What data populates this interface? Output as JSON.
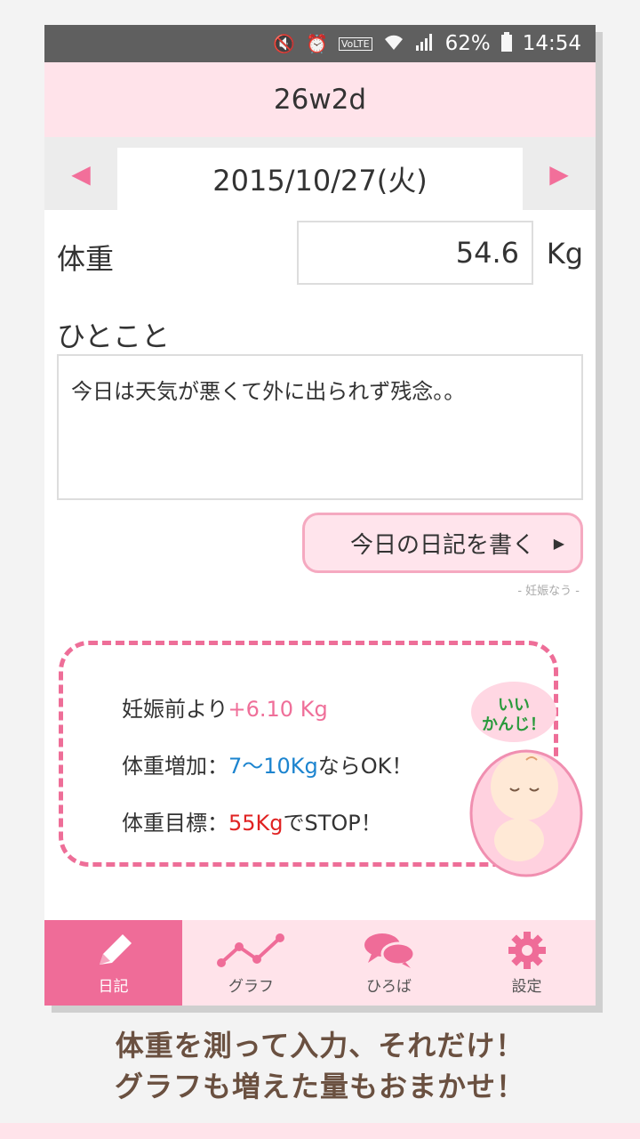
{
  "status_bar": {
    "battery": "62%",
    "time": "14:54",
    "icons": [
      "mute-icon",
      "alarm-icon",
      "volte-icon",
      "wifi-icon",
      "signal-icon",
      "battery-icon"
    ]
  },
  "header": {
    "title": "26w2d"
  },
  "date_nav": {
    "date": "2015/10/27(火)",
    "prev": "◀",
    "next": "▶"
  },
  "weight": {
    "label": "体重",
    "value": "54.6",
    "unit": "Kg"
  },
  "memo": {
    "label": "ひとこと",
    "text": "今日は天気が悪くて外に出られず残念。。"
  },
  "diary_button": {
    "label": "今日の日記を書く",
    "arrow": "▶"
  },
  "credit": "- 妊娠なう -",
  "info": {
    "line1_prefix": "妊娠前より",
    "line1_value": "+6.10 Kg",
    "line2_prefix": "体重増加：",
    "line2_value": "7〜10Kg",
    "line2_suffix": "ならOK！",
    "line3_prefix": "体重目標：",
    "line3_value": "55Kg",
    "line3_suffix": "でSTOP！",
    "bubble_line1": "いい",
    "bubble_line2": "かんじ！"
  },
  "tabs": [
    {
      "label": "日記",
      "icon": "pencil-icon",
      "active": true
    },
    {
      "label": "グラフ",
      "icon": "graph-icon",
      "active": false
    },
    {
      "label": "ひろば",
      "icon": "chat-icon",
      "active": false
    },
    {
      "label": "設定",
      "icon": "gear-icon",
      "active": false
    }
  ],
  "caption": {
    "line1": "体重を測って入力、それだけ！",
    "line2": "グラフも増えた量もおまかせ！"
  },
  "colors": {
    "accent": "#ef6c98",
    "header_bg": "#ffe3ea",
    "blue": "#1c84cf",
    "red": "#e02222",
    "caption": "#6a5040"
  }
}
